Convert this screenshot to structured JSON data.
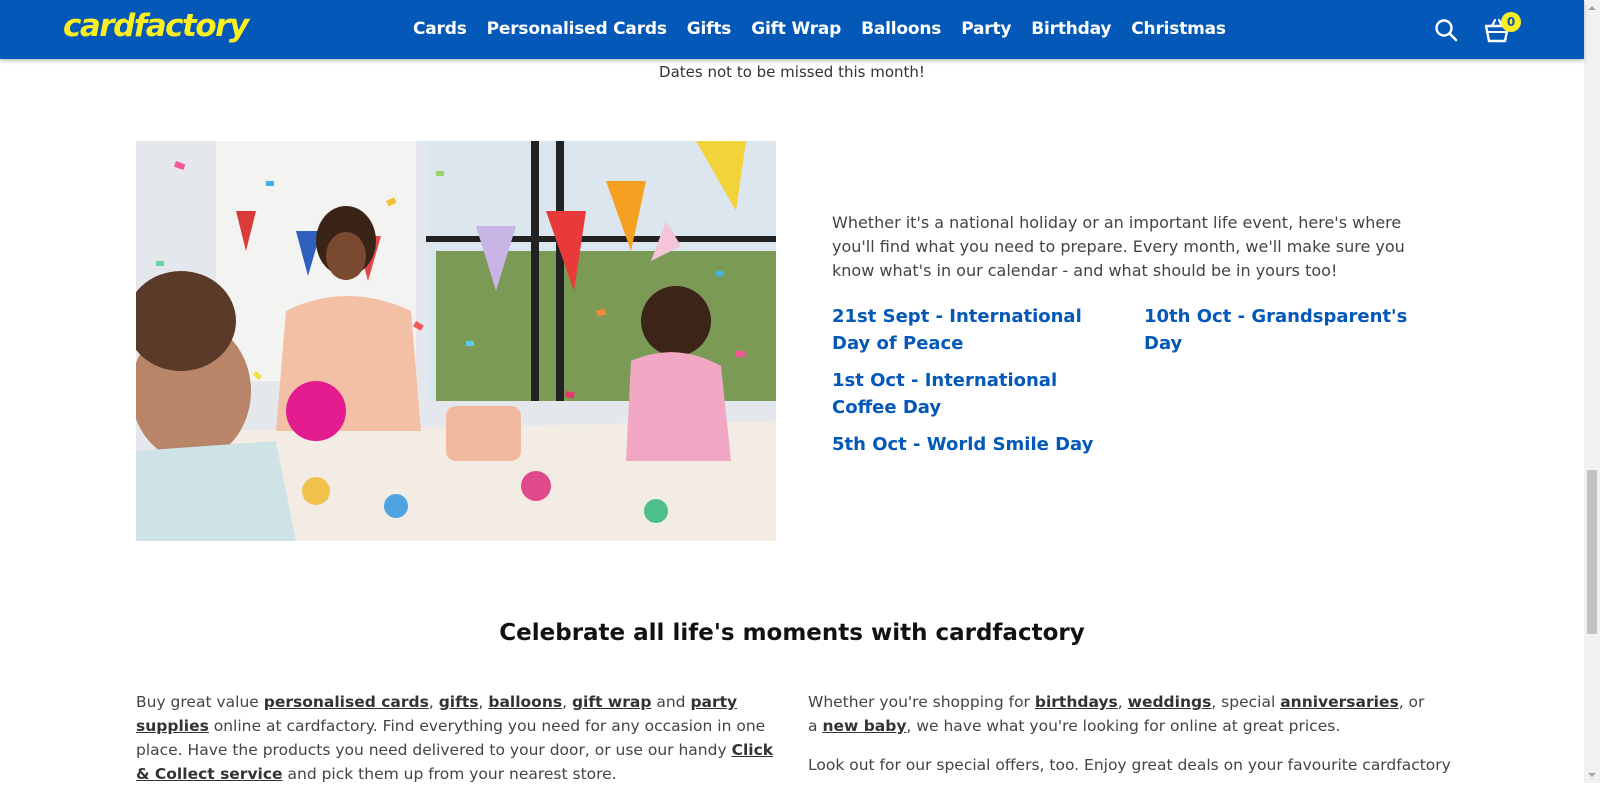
{
  "header": {
    "logo": "cardfactory",
    "nav": [
      "Cards",
      "Personalised Cards",
      "Gifts",
      "Gift Wrap",
      "Balloons",
      "Party",
      "Birthday",
      "Christmas"
    ],
    "basket_count": "0"
  },
  "colors": {
    "brand_blue": "#0358b8",
    "brand_yellow": "#fcee21"
  },
  "dates_intro": "Dates not to be missed this month!",
  "calendar": {
    "description": "Whether it's a national holiday or an important life event, here's where you'll find what you need to prepare. Every month, we'll make sure you know what's in our calendar - and what should be in yours too!",
    "dates": [
      "21st Sept - International Day of Peace",
      "1st Oct - International Coffee Day",
      "5th Oct - World Smile Day",
      "10th Oct - Grandsparent's Day"
    ]
  },
  "celebrate": {
    "title": "Celebrate all life's moments with cardfactory",
    "left": {
      "t1": "Buy great value ",
      "l1": "personalised cards",
      "t2": ", ",
      "l2": "gifts",
      "t3": ", ",
      "l3": "balloons",
      "t4": ", ",
      "l4": "gift wrap",
      "t5": " and ",
      "l5": "party supplies",
      "t6": " online at cardfactory. Find everything you need for any occasion in one place. Have the products you need delivered to your door, or use our handy ",
      "l6": "Click & Collect service",
      "t7": " and pick them up from your nearest store."
    },
    "right": {
      "t1": "Whether you're shopping for ",
      "l1": "birthdays",
      "t2": ", ",
      "l2": "weddings",
      "t3": ", special ",
      "l3": "anniversaries",
      "t4": ", or a ",
      "l4": "new baby",
      "t5": ", we have what you're looking for online at great prices.",
      "p2": "Look out for our special offers, too. Enjoy great deals on your favourite cardfactory"
    }
  }
}
